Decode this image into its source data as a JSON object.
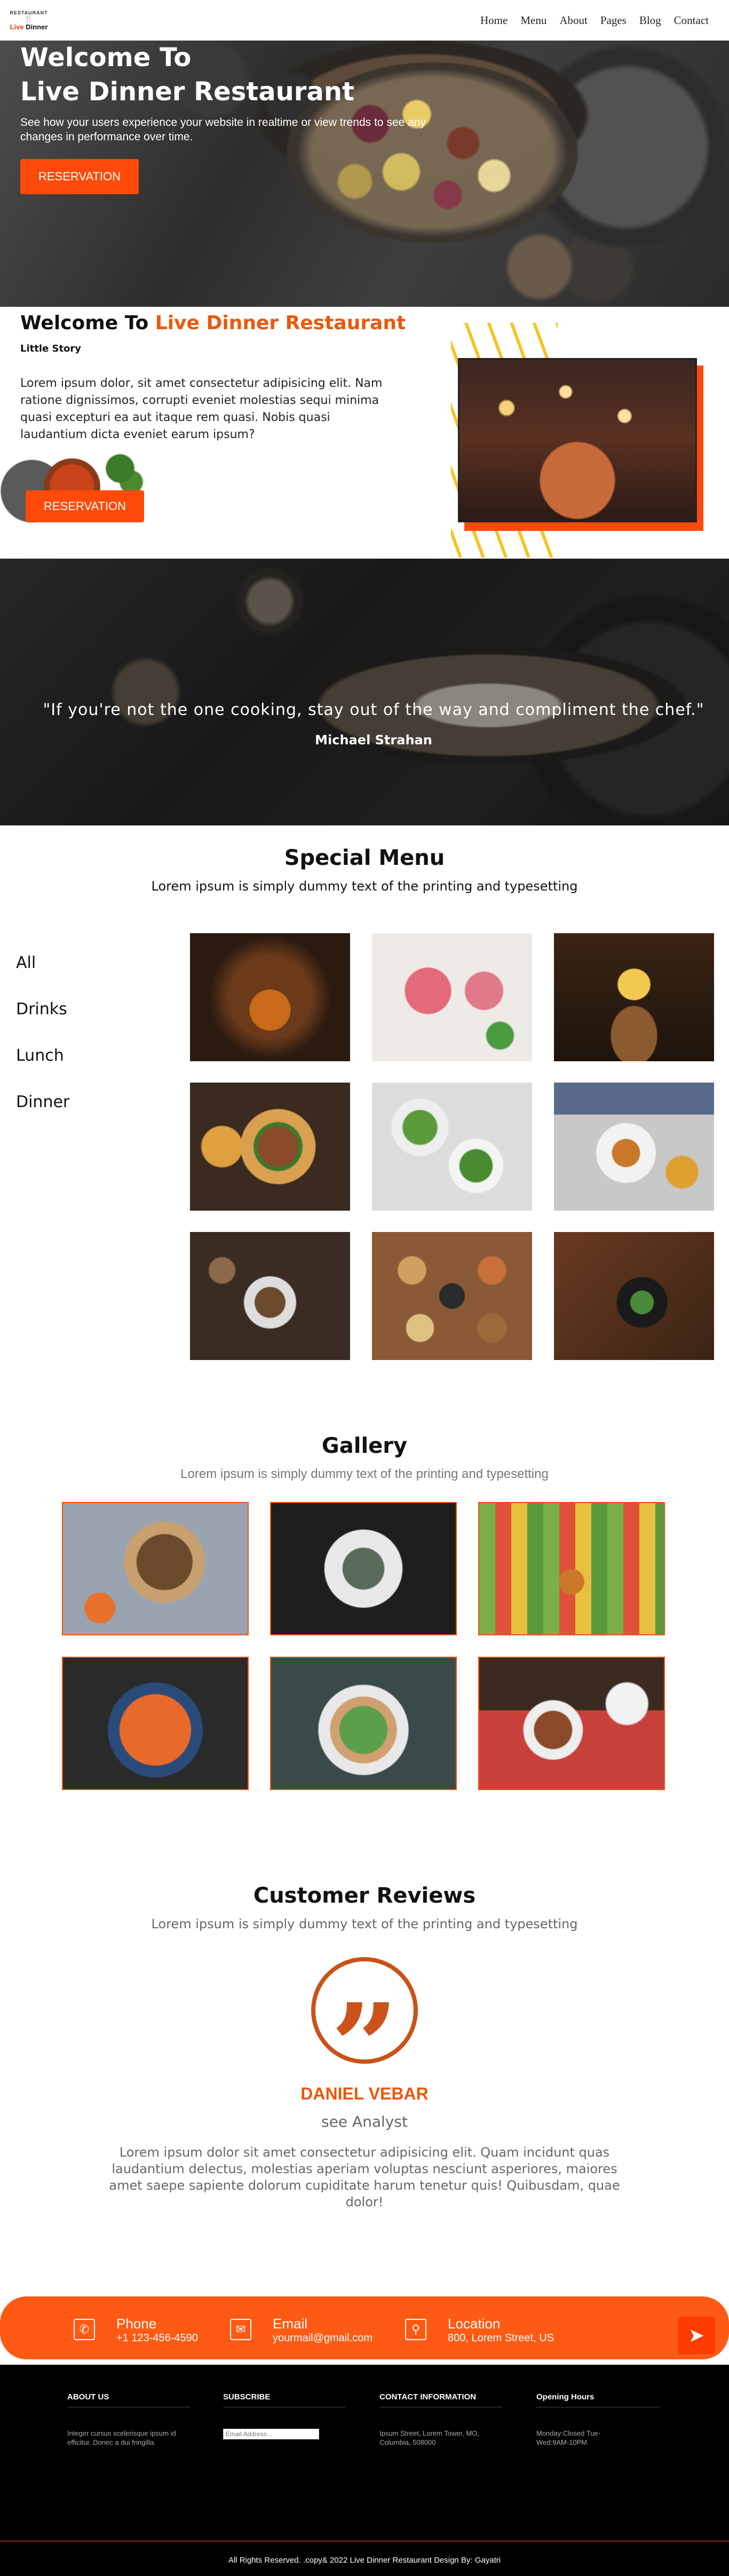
{
  "nav": {
    "logo_arc": "RESTAURANT",
    "logo_brand_a": "Live",
    "logo_brand_b": "Dinner",
    "items": [
      "Home",
      "Menu",
      "About",
      "Pages",
      "Blog",
      "Contact"
    ]
  },
  "hero": {
    "title_line1": "Welcome To",
    "title_line2": "Live Dinner Restaurant",
    "subtitle": "See how your users experience your website in realtime or view trends to see any changes in performance over time.",
    "button": "RESERVATION"
  },
  "welcome": {
    "title_a": "Welcome To",
    "title_b": "Live Dinner Restaurant",
    "story": "Little Story",
    "text": "Lorem ipsum dolor, sit amet consectetur adipisicing elit. Nam ratione dignissimos, corrupti eveniet molestias sequi minima quasi excepturi ea aut itaque rem quasi. Nobis quasi laudantium dicta eveniet earum ipsum?",
    "button": "RESERVATION"
  },
  "quote": {
    "text": "\"If you're not the one cooking, stay out of the way and compliment the chef.\"",
    "author": "Michael Strahan"
  },
  "special": {
    "title": "Special Menu",
    "subtitle": "Lorem ipsum is simply dummy text of the printing and typesetting",
    "categories": [
      "All",
      "Drinks",
      "Lunch",
      "Dinner"
    ]
  },
  "gallery": {
    "title": "Gallery",
    "subtitle": "Lorem ipsum is simply dummy text of the printing and typesetting"
  },
  "reviews": {
    "title": "Customer Reviews",
    "subtitle": "Lorem ipsum is simply dummy text of the printing and typesetting",
    "quote_mark": "”",
    "name": "DANIEL VEBAR",
    "role": "see Analyst",
    "text": "Lorem ipsum dolor sit amet consectetur adipisicing elit. Quam incidunt quas laudantium delectus, molestias aperiam voluptas nesciunt asperiores, maiores amet saepe sapiente dolorum cupiditate harum tenetur quis! Quibusdam, quae dolor!"
  },
  "contact": {
    "phone_title": "Phone",
    "phone_value": "+1 123-456-4590",
    "email_title": "Email",
    "email_value": "yourmail@gmail.com",
    "location_title": "Location",
    "location_value": "800, Lorem Street, US"
  },
  "footer": {
    "about_title": "ABOUT US",
    "about_text": "Integer cursus scelerisque ipsum id efficitur. Donec a dui fringilla.",
    "subscribe_title": "SUBSCRIBE",
    "subscribe_placeholder": "Email Address...",
    "contact_title": "CONTACT INFORMATION",
    "contact_text": "Ipsum Street, Lorem Tower, MO, Columbia, 508000",
    "hours_title": "Opening Hours",
    "hours_text": "Monday:Closed Tue-Wed:9AM-10PM",
    "copyright": "All Rights Reserved. .copy& 2022 Live Dinner Restaurant Design By: Gayatri"
  },
  "colors": {
    "accent": "#ff4a0a",
    "accent_text": "#e8590c",
    "footer_bg": "#000000"
  },
  "icons": [
    "phone-icon",
    "email-icon",
    "location-icon",
    "send-icon"
  ]
}
